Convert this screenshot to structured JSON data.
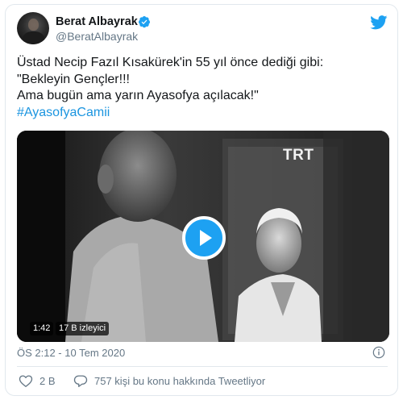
{
  "author": {
    "display_name": "Berat Albayrak",
    "handle": "@BeratAlbayrak",
    "verified": true,
    "avatar_icon": "profile-photo"
  },
  "brand_icon": "twitter-bird-icon",
  "tweet": {
    "lines": [
      "Üstad Necip Fazıl Kısakürek'in 55 yıl önce dediği gibi:",
      "\"Bekleyin Gençler!!!",
      "Ama bugün ama yarın Ayasofya açılacak!\""
    ],
    "hashtag": "#AyasofyaCamii"
  },
  "video": {
    "channel_logo": "TRT",
    "duration": "1:42",
    "views": "17 B izleyici",
    "play_icon": "play-icon"
  },
  "timestamp": "ÖS 2:12 - 10 Tem 2020",
  "actions": {
    "like_count": "2 B",
    "reply_text": "757 kişi bu konu hakkında Tweetliyor"
  },
  "colors": {
    "accent": "#1da1f2",
    "hashtag": "#1b95e0",
    "secondary_text": "#657786",
    "border": "#e1e8ed"
  }
}
